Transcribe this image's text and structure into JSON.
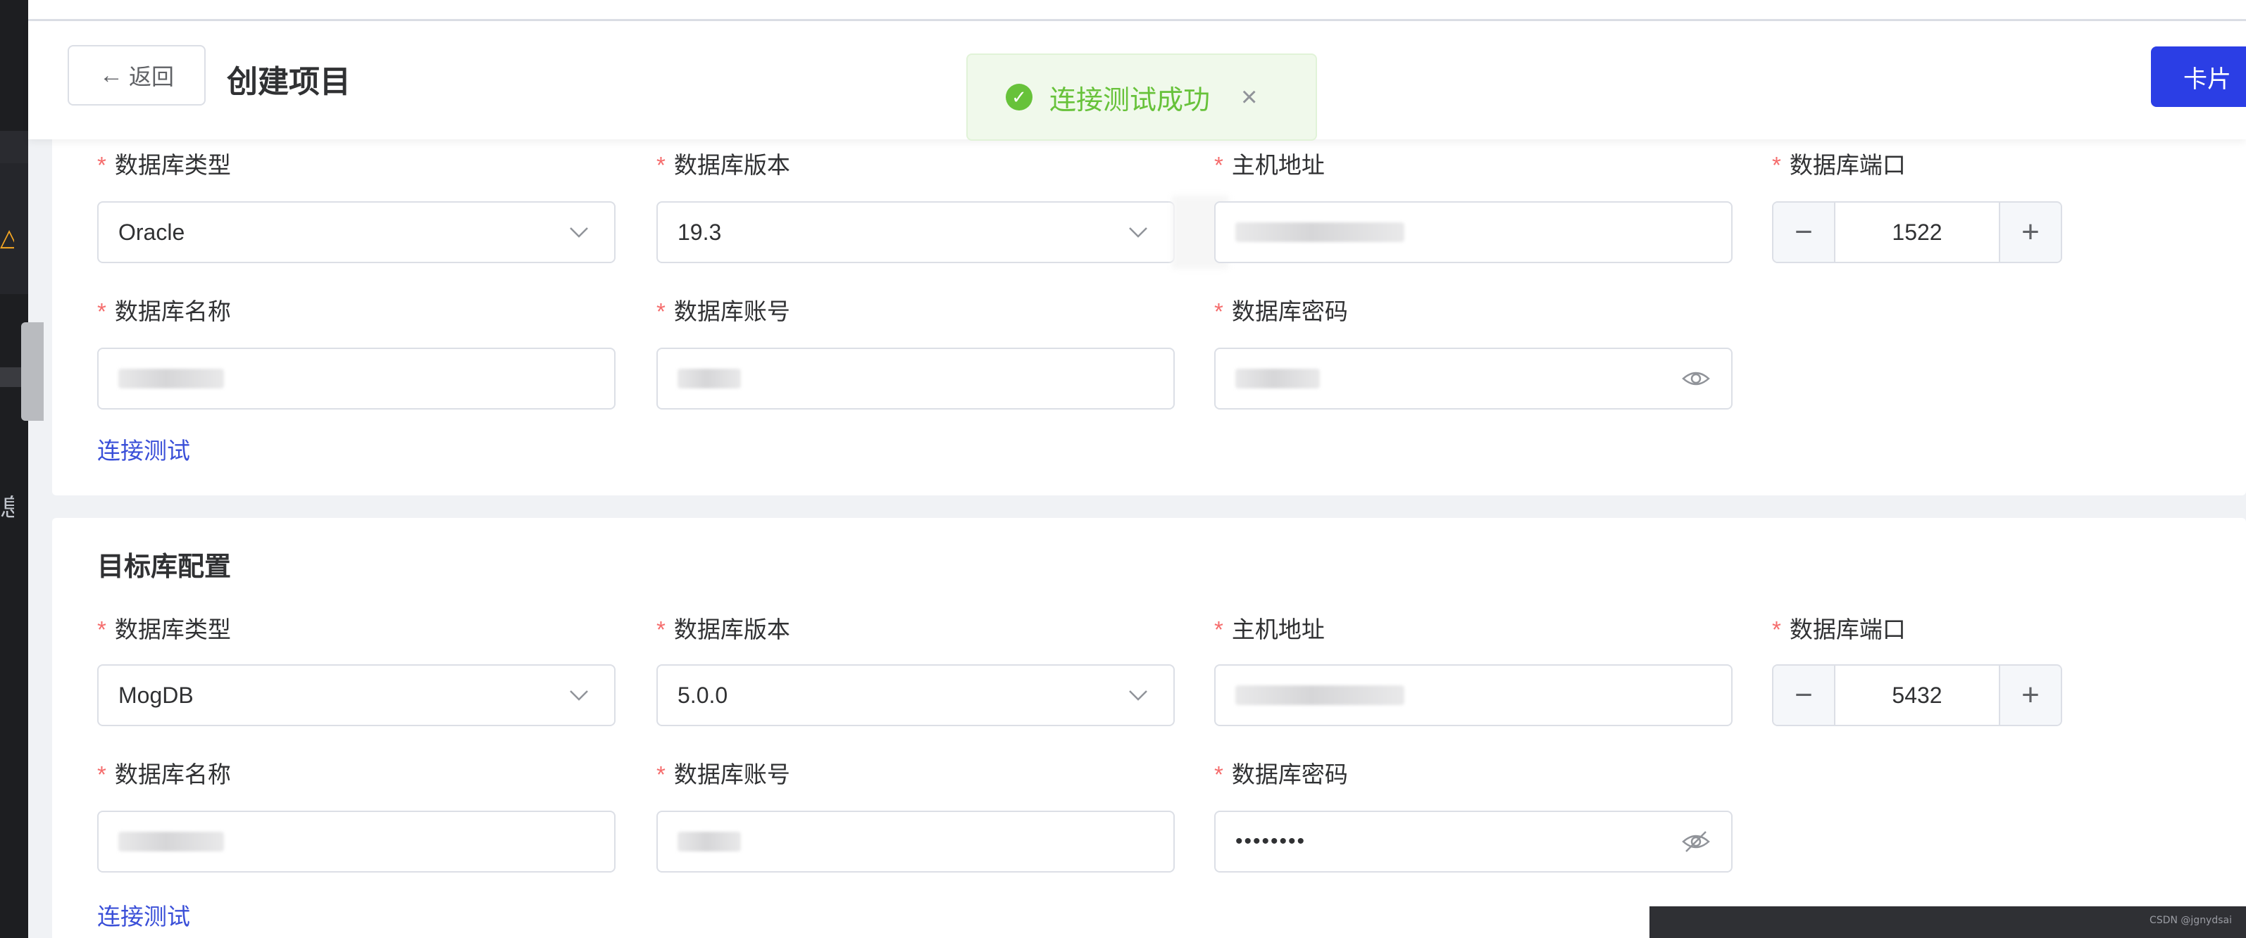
{
  "header": {
    "back_label": "返回",
    "title": "创建项目",
    "card_button": "卡片"
  },
  "toast": {
    "message": "连接测试成功",
    "icon": "check-circle-icon",
    "close": "×"
  },
  "sidebar": {
    "warn_icon": "△",
    "partial_char": "息"
  },
  "source": {
    "labels": {
      "db_type": "数据库类型",
      "db_version": "数据库版本",
      "host": "主机地址",
      "port": "数据库端口",
      "db_name": "数据库名称",
      "account": "数据库账号",
      "password": "数据库密码"
    },
    "values": {
      "db_type": "Oracle",
      "db_version": "19.3",
      "port": "1522"
    },
    "test_link": "连接测试"
  },
  "target": {
    "section_title": "目标库配置",
    "labels": {
      "db_type": "数据库类型",
      "db_version": "数据库版本",
      "host": "主机地址",
      "port": "数据库端口",
      "db_name": "数据库名称",
      "account": "数据库账号",
      "password": "数据库密码"
    },
    "values": {
      "db_type": "MogDB",
      "db_version": "5.0.0",
      "port": "5432",
      "password_mask": "••••••••"
    },
    "test_link": "连接测试"
  },
  "stepper": {
    "minus": "−",
    "plus": "+"
  },
  "required_mark": "*",
  "watermark": "CSDN @jgnydsai",
  "colors": {
    "primary": "#2b3ee5",
    "success": "#67c23a",
    "required": "#f56c6c",
    "link": "#3a4fd8"
  }
}
